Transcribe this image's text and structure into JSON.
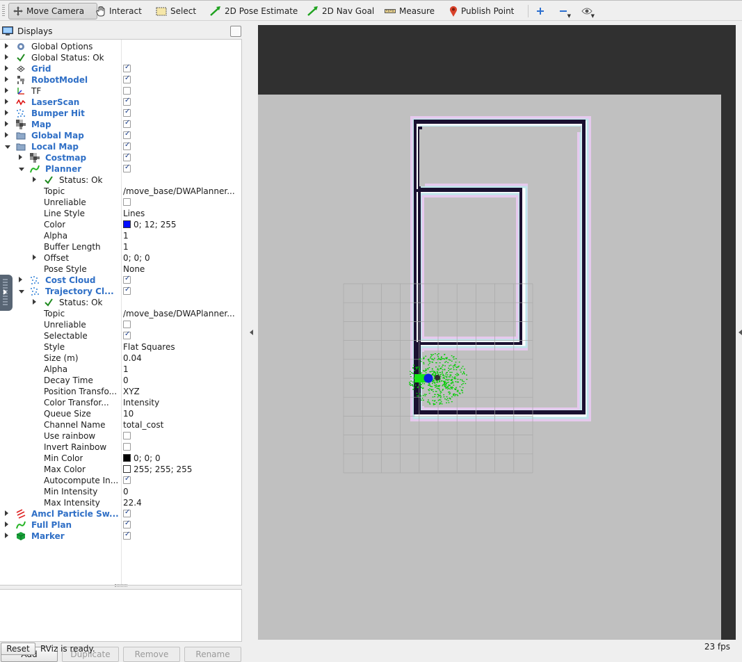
{
  "toolbar": {
    "tools": [
      {
        "label": "Move Camera",
        "icon": "move-camera-icon",
        "active": true
      },
      {
        "label": "Interact",
        "icon": "hand-icon"
      },
      {
        "label": "Select",
        "icon": "select-box-icon"
      },
      {
        "label": "2D Pose Estimate",
        "icon": "green-arrow-icon"
      },
      {
        "label": "2D Nav Goal",
        "icon": "green-arrow-icon"
      },
      {
        "label": "Measure",
        "icon": "ruler-icon"
      },
      {
        "label": "Publish Point",
        "icon": "map-pin-icon"
      }
    ],
    "extra_icons": [
      "plus-icon",
      "minus-icon",
      "eye-icon"
    ]
  },
  "displays": {
    "title": "Displays",
    "tree": [
      {
        "label": "Global Options",
        "depth": 0,
        "icon": "gear-icon",
        "expander": "closed"
      },
      {
        "label": "Global Status: Ok",
        "depth": 0,
        "icon": "check-icon",
        "expander": "closed"
      },
      {
        "label": "Grid",
        "depth": 0,
        "icon": "grid-icon",
        "expander": "closed",
        "bold": true,
        "checked": true
      },
      {
        "label": "RobotModel",
        "depth": 0,
        "icon": "robot-icon",
        "expander": "closed",
        "bold": true,
        "checked": true
      },
      {
        "label": "TF",
        "depth": 0,
        "icon": "axes-icon",
        "expander": "closed",
        "checked": false
      },
      {
        "label": "LaserScan",
        "depth": 0,
        "icon": "laser-icon",
        "expander": "closed",
        "bold": true,
        "checked": true
      },
      {
        "label": "Bumper Hit",
        "depth": 0,
        "icon": "points-icon",
        "expander": "closed",
        "bold": true,
        "checked": true
      },
      {
        "label": "Map",
        "depth": 0,
        "icon": "map-icon",
        "expander": "closed",
        "bold": true,
        "checked": true
      },
      {
        "label": "Global Map",
        "depth": 0,
        "icon": "folder-icon",
        "expander": "closed",
        "bold": true,
        "checked": true
      },
      {
        "label": "Local Map",
        "depth": 0,
        "icon": "folder-icon",
        "expander": "open",
        "bold": true,
        "checked": true
      },
      {
        "label": "Costmap",
        "depth": 1,
        "icon": "map-icon",
        "expander": "closed",
        "bold": true,
        "checked": true
      },
      {
        "label": "Planner",
        "depth": 1,
        "icon": "path-icon",
        "expander": "open",
        "bold": true,
        "checked": true
      },
      {
        "label": "Status: Ok",
        "depth": 2,
        "icon": "check-icon",
        "expander": "closed"
      },
      {
        "label": "Topic",
        "depth": 2,
        "value": "/move_base/DWAPlanner..."
      },
      {
        "label": "Unreliable",
        "depth": 2,
        "checked": false
      },
      {
        "label": "Line Style",
        "depth": 2,
        "value": "Lines"
      },
      {
        "label": "Color",
        "depth": 2,
        "value": "0; 12; 255",
        "swatch": "#000cff"
      },
      {
        "label": "Alpha",
        "depth": 2,
        "value": "1"
      },
      {
        "label": "Buffer Length",
        "depth": 2,
        "value": "1"
      },
      {
        "label": "Offset",
        "depth": 2,
        "value": "0; 0; 0",
        "expander": "closed"
      },
      {
        "label": "Pose Style",
        "depth": 2,
        "value": "None"
      },
      {
        "label": "Cost Cloud",
        "depth": 1,
        "icon": "points-icon",
        "expander": "closed",
        "bold": true,
        "checked": true
      },
      {
        "label": "Trajectory Cl...",
        "depth": 1,
        "icon": "points-icon",
        "expander": "open",
        "bold": true,
        "checked": true
      },
      {
        "label": "Status: Ok",
        "depth": 2,
        "icon": "check-icon",
        "expander": "closed"
      },
      {
        "label": "Topic",
        "depth": 2,
        "value": "/move_base/DWAPlanner..."
      },
      {
        "label": "Unreliable",
        "depth": 2,
        "checked": false
      },
      {
        "label": "Selectable",
        "depth": 2,
        "checked": true
      },
      {
        "label": "Style",
        "depth": 2,
        "value": "Flat Squares"
      },
      {
        "label": "Size (m)",
        "depth": 2,
        "value": "0.04"
      },
      {
        "label": "Alpha",
        "depth": 2,
        "value": "1"
      },
      {
        "label": "Decay Time",
        "depth": 2,
        "value": "0"
      },
      {
        "label": "Position Transfo...",
        "depth": 2,
        "value": "XYZ"
      },
      {
        "label": "Color Transfor...",
        "depth": 2,
        "value": "Intensity"
      },
      {
        "label": "Queue Size",
        "depth": 2,
        "value": "10"
      },
      {
        "label": "Channel Name",
        "depth": 2,
        "value": "total_cost"
      },
      {
        "label": "Use rainbow",
        "depth": 2,
        "checked": false
      },
      {
        "label": "Invert Rainbow",
        "depth": 2,
        "checked": false
      },
      {
        "label": "Min Color",
        "depth": 2,
        "value": "0; 0; 0",
        "swatch": "#000000"
      },
      {
        "label": "Max Color",
        "depth": 2,
        "value": "255; 255; 255",
        "swatch": "#ffffff"
      },
      {
        "label": "Autocompute In...",
        "depth": 2,
        "checked": true
      },
      {
        "label": "Min Intensity",
        "depth": 2,
        "value": "0"
      },
      {
        "label": "Max Intensity",
        "depth": 2,
        "value": "22.4"
      },
      {
        "label": "Amcl Particle Sw...",
        "depth": 0,
        "icon": "arrows-icon",
        "expander": "closed",
        "bold": true,
        "checked": true
      },
      {
        "label": "Full Plan",
        "depth": 0,
        "icon": "path-icon",
        "expander": "closed",
        "bold": true,
        "checked": true
      },
      {
        "label": "Marker",
        "depth": 0,
        "icon": "cube-icon",
        "expander": "closed",
        "bold": true,
        "checked": true
      }
    ],
    "buttons": {
      "add": "Add",
      "duplicate": "Duplicate",
      "remove": "Remove",
      "rename": "Rename"
    }
  },
  "status": {
    "reset": "Reset",
    "message": "RViz is ready.",
    "fps": "23 fps"
  },
  "colors": {
    "accent": "#2f6fc6",
    "map_bg": "#c0c0c0",
    "view_bg": "#303030",
    "wall": "#1a1030",
    "planner": "#000cff",
    "cloud": "#00cc00"
  }
}
